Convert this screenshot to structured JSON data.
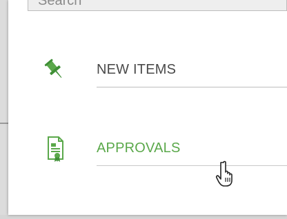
{
  "search": {
    "placeholder": "Search"
  },
  "menu": {
    "items": [
      {
        "label": "NEW ITEMS",
        "icon": "pin-icon",
        "color": "#4a4a4a"
      },
      {
        "label": "APPROVALS",
        "icon": "document-certificate-icon",
        "color": "#5aa84a"
      }
    ]
  },
  "colors": {
    "accent": "#5aa84a",
    "text": "#4a4a4a"
  }
}
